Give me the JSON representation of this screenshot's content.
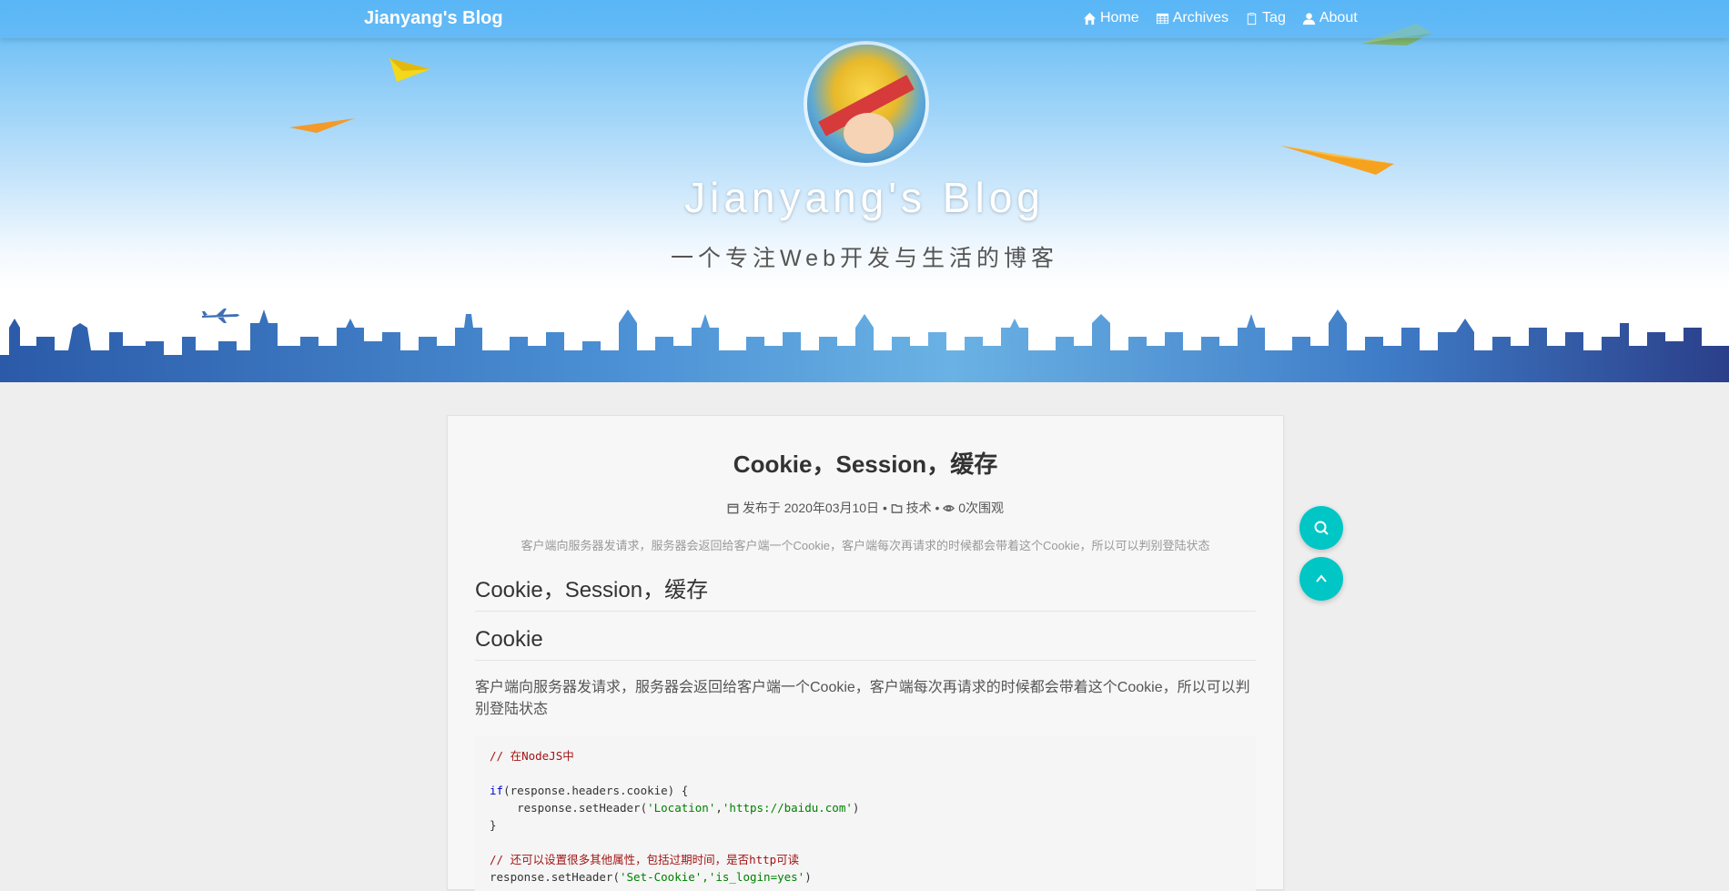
{
  "nav": {
    "brand": "Jianyang's Blog",
    "items": [
      {
        "label": "Home",
        "icon": "home-icon"
      },
      {
        "label": "Archives",
        "icon": "grid-icon"
      },
      {
        "label": "Tag",
        "icon": "tag-icon"
      },
      {
        "label": "About",
        "icon": "user-icon"
      }
    ]
  },
  "hero": {
    "title": "Jianyang's Blog",
    "subtitle": "一个专注Web开发与生活的博客"
  },
  "post": {
    "title": "Cookie，Session，缓存",
    "meta": {
      "published_prefix": "发布于",
      "date": "2020年03月10日",
      "category": "技术",
      "views": "0次围观",
      "separator": "•"
    },
    "excerpt": "客户端向服务器发请求，服务器会返回给客户端一个Cookie，客户端每次再请求的时候都会带着这个Cookie，所以可以判别登陆状态",
    "h2": "Cookie，Session，缓存",
    "h3": "Cookie",
    "paragraph": "客户端向服务器发请求，服务器会返回给客户端一个Cookie，客户端每次再请求的时候都会带着这个Cookie，所以可以判别登陆状态",
    "code": {
      "comment1": "// 在NodeJS中",
      "if_kw": "if",
      "if_rest": "(response.headers.cookie) {",
      "set_prefix": "    response.setHeader(",
      "str1": "'Location'",
      "comma": ",",
      "str2": "'https://baidu.com'",
      "set_suffix": ")",
      "close": "}",
      "comment2": "// 还可以设置很多其他属性，包括过期时间，是否http可读",
      "partial_prefix": "response.setHeader(",
      "partial_str": "'Set-Cookie','is_login=yes'",
      "partial_suffix": ")"
    }
  },
  "colors": {
    "accent": "#00c6c6",
    "nav_bg": "#5bb8f5",
    "page_bg": "#eeeeee"
  },
  "fabs": [
    {
      "icon": "search-icon"
    },
    {
      "icon": "chevron-up-icon"
    }
  ]
}
